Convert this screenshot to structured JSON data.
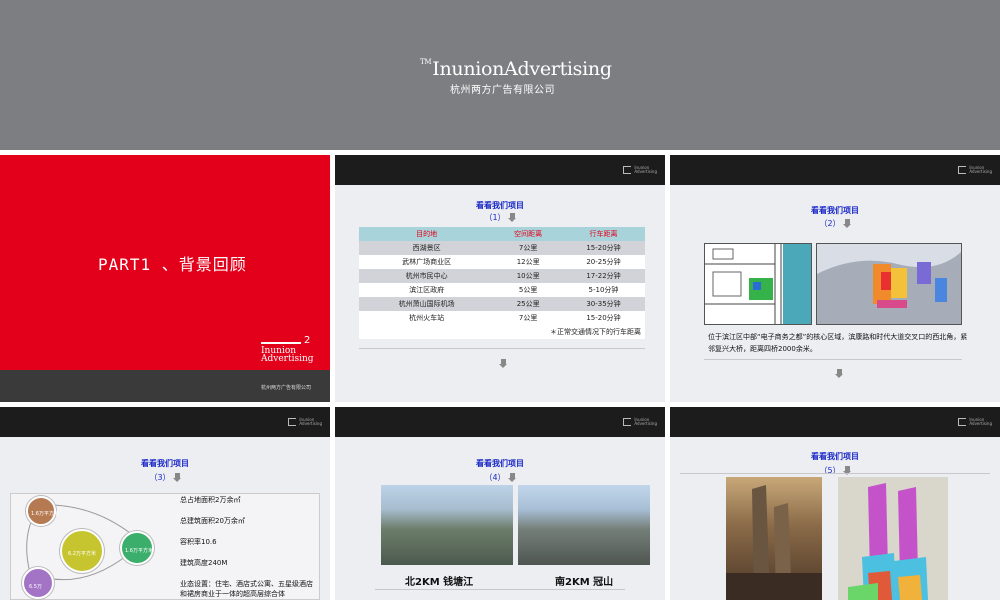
{
  "header": {
    "brand_tm": "TM",
    "brand": "InunionAdvertising",
    "company_cn": "杭州两方广告有限公司"
  },
  "slide1": {
    "title": "PART1 、背景回顾",
    "badge_num": "2",
    "logo_line1": "Inunion",
    "logo_line2": "Advertising",
    "footer": "杭州两方广告有限公司"
  },
  "slide2": {
    "title": "看看我们项目",
    "num": "（1）",
    "columns": [
      "目的地",
      "空间距离",
      "行车距离"
    ],
    "rows": [
      [
        "西湖景区",
        "7公里",
        "15-20分钟"
      ],
      [
        "武林广场商业区",
        "12公里",
        "20-25分钟"
      ],
      [
        "杭州市民中心",
        "10公里",
        "17-22分钟"
      ],
      [
        "滨江区政府",
        "5公里",
        "5-10分钟"
      ],
      [
        "杭州萧山国际机场",
        "25公里",
        "30-35分钟"
      ],
      [
        "杭州火车站",
        "7公里",
        "15-20分钟"
      ]
    ],
    "note": "＊正常交通情况下的行车距离"
  },
  "slide3": {
    "title": "看看我们项目",
    "num": "（2）",
    "desc": "位于滨江区中部“电子商务之都”的核心区域，滨康路和时代大道交叉口的西北角，紧邻复兴大桥，距离四桥2000余米。"
  },
  "slide4": {
    "title": "看看我们项目",
    "num": "（3）",
    "circle_labels": [
      "1.6万平方米",
      "6.2万平方米",
      "1.6万平方米",
      "6.5万"
    ],
    "stats": [
      "总占地面积2万余㎡",
      "总建筑面积20万余㎡",
      "容积率10.6",
      "建筑高度240M",
      "业态设置：住宅、酒店式公寓、五星级酒店和裙房商业于一体的超高层综合体"
    ]
  },
  "slide5": {
    "title": "看看我们项目",
    "num": "（4）",
    "captions": [
      "北2KM  钱塘江",
      "南2KM  冠山"
    ]
  },
  "slide6": {
    "title": "看看我们项目",
    "num": "（5）"
  },
  "colors": {
    "header_gray": "#7d7e82",
    "red": "#e3001b",
    "dark_bar": "#1c1c1c",
    "blue_title": "#1a28c8",
    "table_head": "#a9d3da"
  }
}
